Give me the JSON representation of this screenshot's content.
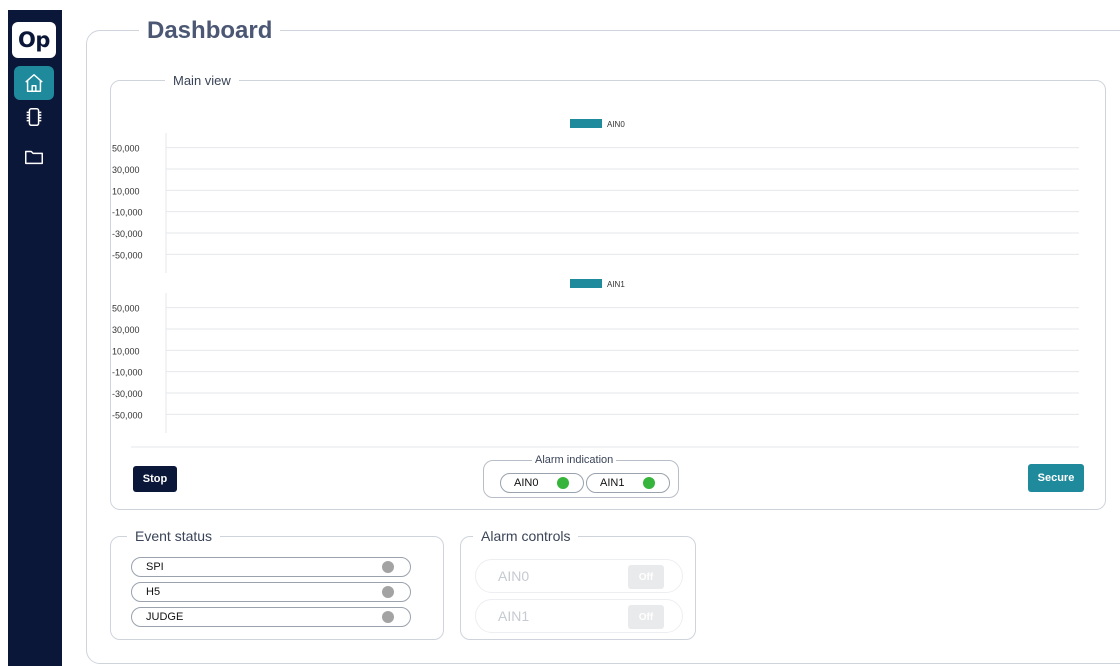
{
  "app": {
    "logo": "Op"
  },
  "sidebar": {
    "items": [
      {
        "name": "home",
        "icon": "home-icon",
        "active": true
      },
      {
        "name": "device",
        "icon": "chip-icon",
        "active": false
      },
      {
        "name": "files",
        "icon": "folder-icon",
        "active": false
      }
    ]
  },
  "dashboard": {
    "title": "Dashboard"
  },
  "main_view": {
    "title": "Main view",
    "stop_label": "Stop",
    "secure_label": "Secure"
  },
  "chart_data": [
    {
      "type": "bar",
      "series": [
        {
          "name": "AIN0",
          "values": []
        }
      ],
      "yticks": [
        50000,
        30000,
        10000,
        -10000,
        -30000,
        -50000
      ],
      "ytick_labels": [
        "50,000",
        "30,000",
        "10,000",
        "-10,000",
        "-30,000",
        "-50,000"
      ],
      "ylim": [
        -60000,
        60000
      ],
      "grid": true,
      "legend_position": "top",
      "color": "#1f8a9c"
    },
    {
      "type": "bar",
      "series": [
        {
          "name": "AIN1",
          "values": []
        }
      ],
      "yticks": [
        50000,
        30000,
        10000,
        -10000,
        -30000,
        -50000
      ],
      "ytick_labels": [
        "50,000",
        "30,000",
        "10,000",
        "-10,000",
        "-30,000",
        "-50,000"
      ],
      "ylim": [
        -60000,
        60000
      ],
      "grid": true,
      "legend_position": "top",
      "color": "#1f8a9c"
    }
  ],
  "alarm_indication": {
    "title": "Alarm indication",
    "items": [
      {
        "label": "AIN0",
        "status": "green"
      },
      {
        "label": "AIN1",
        "status": "green"
      }
    ]
  },
  "event_status": {
    "title": "Event status",
    "items": [
      {
        "label": "SPI",
        "status": "grey"
      },
      {
        "label": "H5",
        "status": "grey"
      },
      {
        "label": "JUDGE",
        "status": "grey"
      }
    ]
  },
  "alarm_controls": {
    "title": "Alarm controls",
    "items": [
      {
        "label": "AIN0",
        "state": "Off"
      },
      {
        "label": "AIN1",
        "state": "Off"
      }
    ]
  },
  "colors": {
    "sidebar_bg": "#0b1738",
    "accent": "#1f8a9c",
    "led_ok": "#36b43b",
    "led_idle": "#a3a3a3"
  }
}
